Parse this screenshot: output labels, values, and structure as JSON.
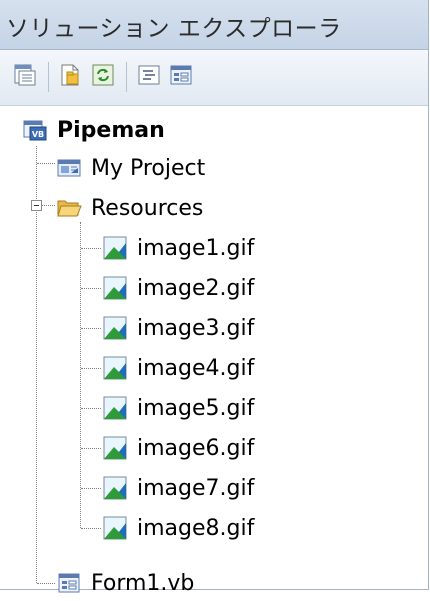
{
  "window": {
    "title": "ソリューション エクスプローラ"
  },
  "toolbar": {
    "buttons": [
      {
        "icon": "properties-icon"
      },
      {
        "icon": "show-all-files-icon"
      },
      {
        "icon": "refresh-icon"
      },
      {
        "icon": "view-code-icon"
      },
      {
        "icon": "view-designer-icon"
      }
    ]
  },
  "tree": {
    "root": {
      "label": "Pipeman",
      "icon": "vb-project-icon"
    },
    "my_project": {
      "label": "My Project",
      "icon": "project-properties-icon"
    },
    "resources": {
      "label": "Resources",
      "icon": "folder-open-icon",
      "expanded": true
    },
    "images": [
      {
        "label": "image1.gif"
      },
      {
        "label": "image2.gif"
      },
      {
        "label": "image3.gif"
      },
      {
        "label": "image4.gif"
      },
      {
        "label": "image5.gif"
      },
      {
        "label": "image6.gif"
      },
      {
        "label": "image7.gif"
      },
      {
        "label": "image8.gif"
      }
    ],
    "form": {
      "label": "Form1.vb",
      "icon": "form-icon"
    }
  }
}
